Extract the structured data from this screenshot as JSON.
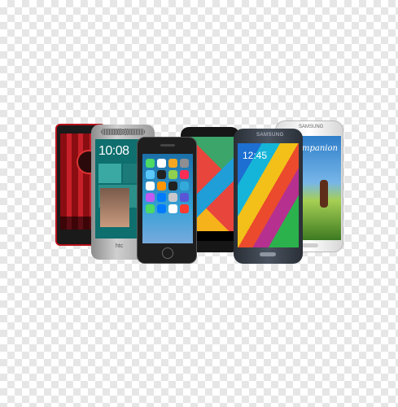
{
  "image": {
    "description": "",
    "phones": [
      {
        "name": "red-droid-phone"
      },
      {
        "name": "htc-phone",
        "clock": "10:08",
        "logo": "htc"
      },
      {
        "name": "iphone"
      },
      {
        "name": "nexus-phone"
      },
      {
        "name": "samsung-galaxy-s5",
        "brand": "SAMSUNG",
        "clock": "12:45"
      },
      {
        "name": "samsung-galaxy-s4",
        "brand": "SAMSUNG",
        "caption": "mpanion"
      }
    ],
    "colors": {
      "checker_light": "#ffffff",
      "checker_dark": "#e6e6e6",
      "droid_red": "#b5121b",
      "htc_teal": "#0e6f6e",
      "ios_blue": "#1b6fa8",
      "s5_blue": "#1d6fd1"
    }
  }
}
